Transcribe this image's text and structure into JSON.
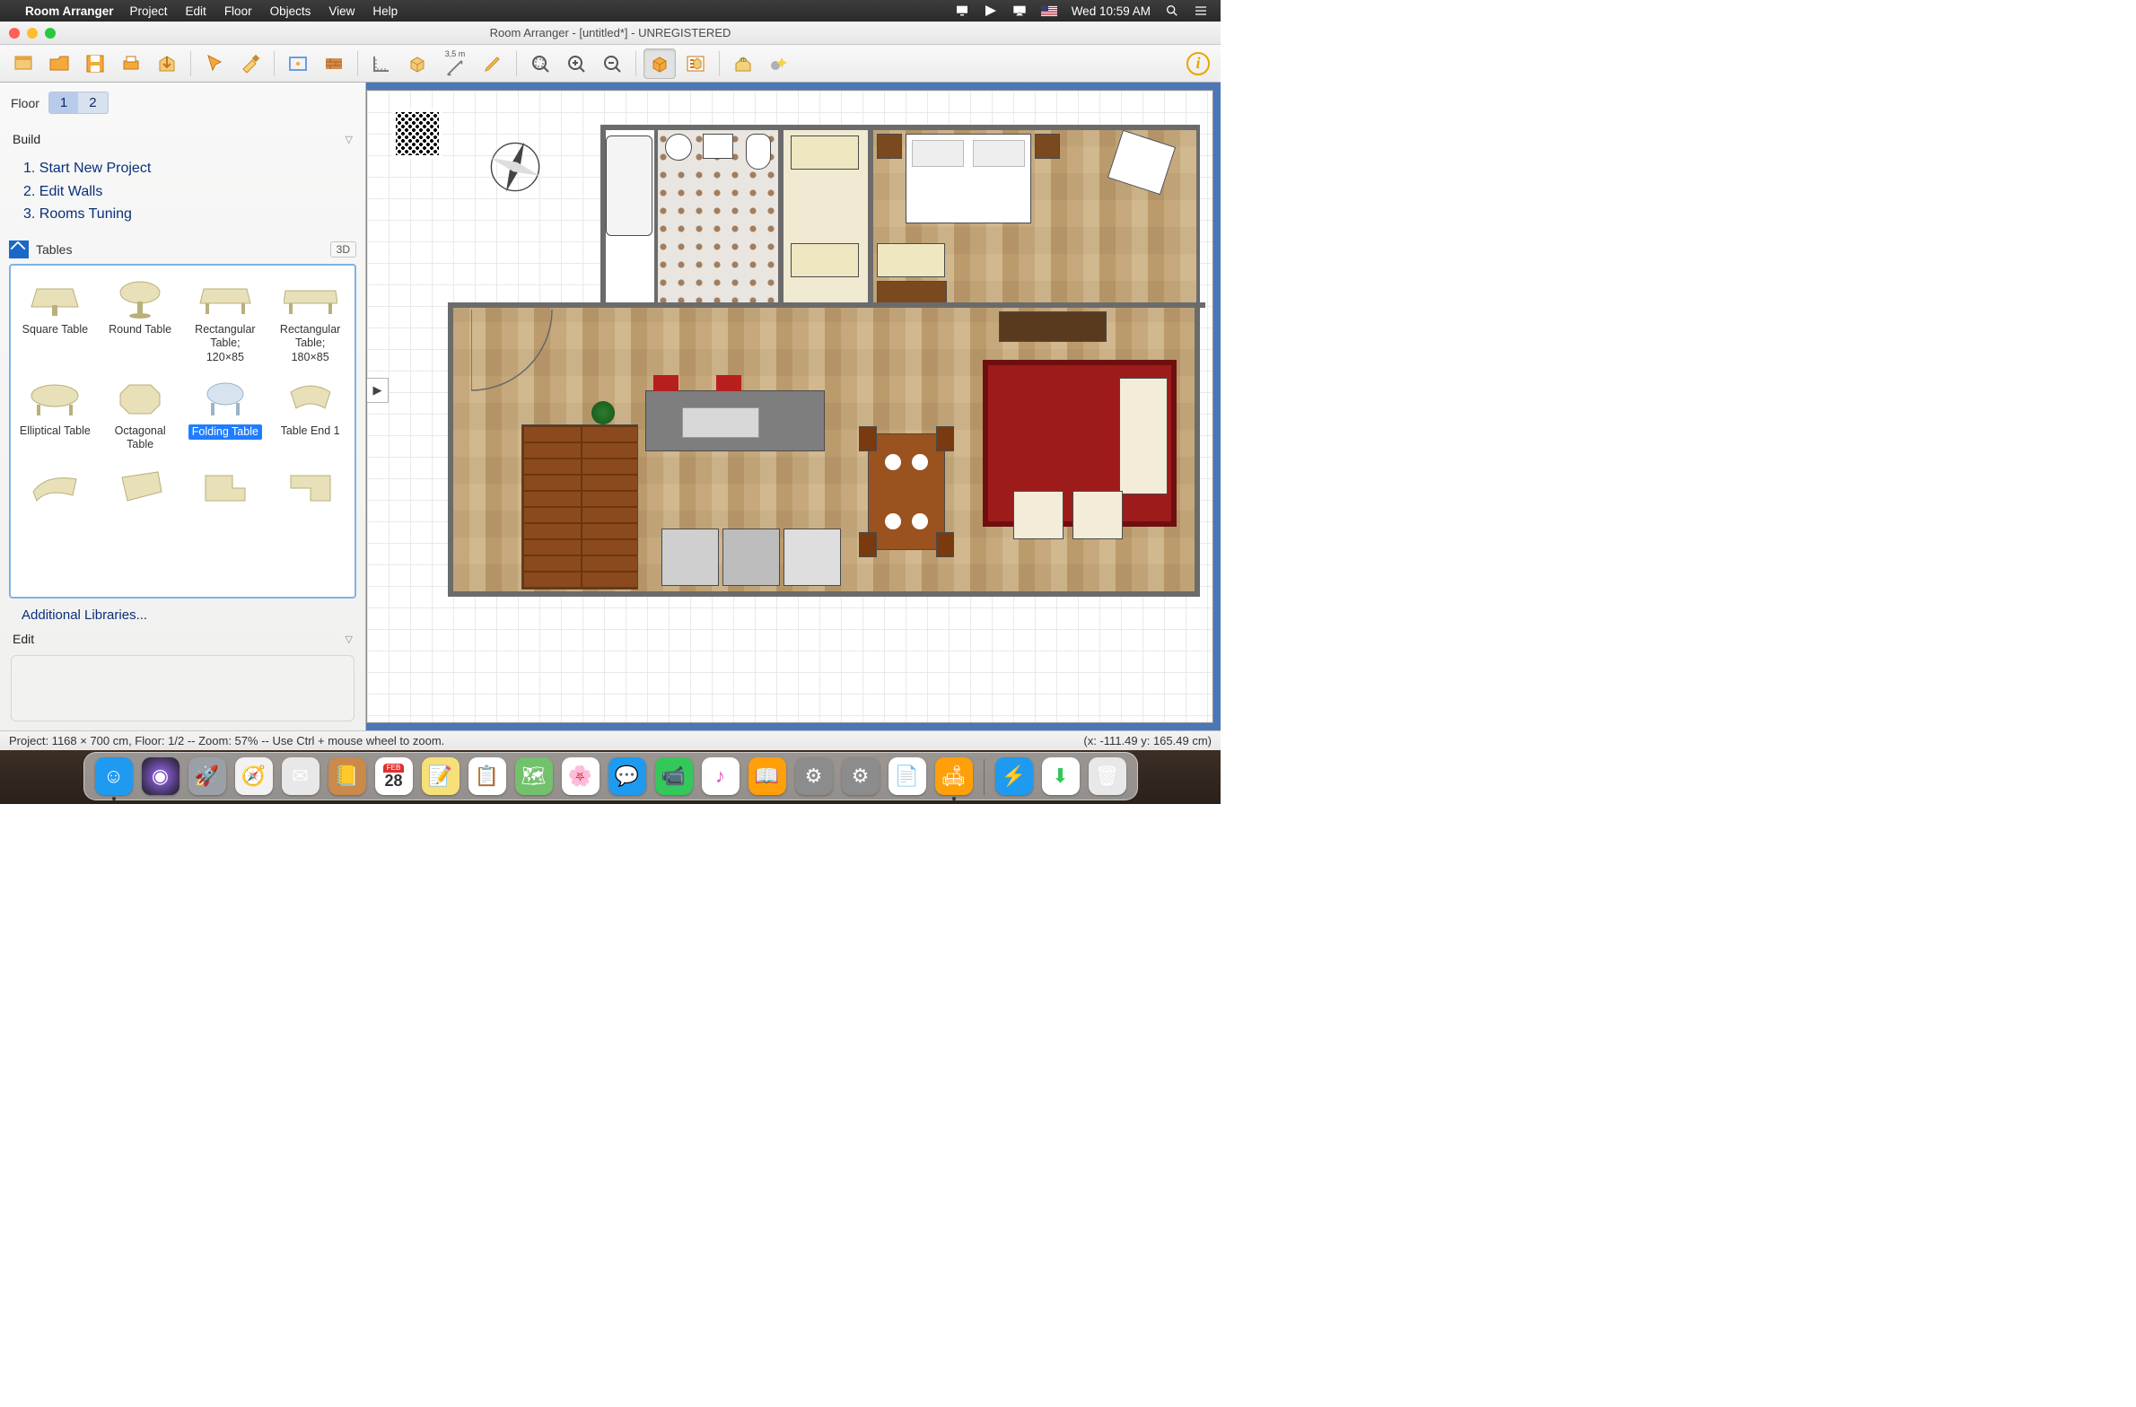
{
  "menubar": {
    "app": "Room Arranger",
    "items": [
      "Project",
      "Edit",
      "Floor",
      "Objects",
      "View",
      "Help"
    ],
    "clock": "Wed 10:59 AM"
  },
  "window": {
    "title": "Room Arranger - [untitled*] - UNREGISTERED"
  },
  "toolbar": {
    "buttons": [
      {
        "id": "new-project",
        "svg": "new"
      },
      {
        "id": "open-project",
        "svg": "open"
      },
      {
        "id": "save-project",
        "svg": "save"
      },
      {
        "id": "print",
        "svg": "print"
      },
      {
        "id": "export",
        "svg": "export"
      },
      {
        "sep": true
      },
      {
        "id": "cursor",
        "svg": "cursor"
      },
      {
        "id": "paint",
        "svg": "paint"
      },
      {
        "sep": true
      },
      {
        "id": "floor-shape",
        "svg": "floorshape"
      },
      {
        "id": "wall-tool",
        "svg": "wall"
      },
      {
        "sep": true
      },
      {
        "id": "ruler-tool",
        "svg": "rulerL"
      },
      {
        "id": "box-tool",
        "svg": "box3d"
      },
      {
        "id": "measure",
        "svg": "measure",
        "label": "3,5 m"
      },
      {
        "id": "pencil",
        "svg": "pencil"
      },
      {
        "sep": true
      },
      {
        "id": "zoom-fit",
        "svg": "zoomfit"
      },
      {
        "id": "zoom-in",
        "svg": "zoomin"
      },
      {
        "id": "zoom-out",
        "svg": "zoomout"
      },
      {
        "sep": true
      },
      {
        "id": "view-3d",
        "svg": "cube",
        "active": true
      },
      {
        "id": "object-list",
        "svg": "objlist"
      },
      {
        "sep": true
      },
      {
        "id": "render-3d",
        "svg": "house3d"
      },
      {
        "id": "effects",
        "svg": "spark"
      }
    ]
  },
  "sidebar": {
    "floor_label": "Floor",
    "floors": [
      "1",
      "2"
    ],
    "floor_selected": 0,
    "build_label": "Build",
    "build_items": [
      "1. Start New Project",
      "2. Edit Walls",
      "3. Rooms Tuning"
    ],
    "category": "Tables",
    "badge3d": "3D",
    "items": [
      {
        "label": "Square Table",
        "shape": "square"
      },
      {
        "label": "Round Table",
        "shape": "round"
      },
      {
        "label": "Rectangular Table; 120×85",
        "shape": "rect"
      },
      {
        "label": "Rectangular Table; 180×85",
        "shape": "rect-long"
      },
      {
        "label": "Elliptical Table",
        "shape": "ellipse"
      },
      {
        "label": "Octagonal Table",
        "shape": "octagon"
      },
      {
        "label": "Folding Table",
        "shape": "folding",
        "selected": true
      },
      {
        "label": "Table End 1",
        "shape": "wedge"
      },
      {
        "label": "",
        "shape": "frag1"
      },
      {
        "label": "",
        "shape": "frag2"
      },
      {
        "label": "",
        "shape": "frag3"
      },
      {
        "label": "",
        "shape": "frag4"
      }
    ],
    "additional": "Additional Libraries...",
    "edit_label": "Edit"
  },
  "status": {
    "left": "Project: 1168 × 700 cm, Floor: 1/2 -- Zoom: 57% -- Use Ctrl + mouse wheel to zoom.",
    "right": "(x: -111.49 y: 165.49 cm)"
  },
  "dock": {
    "apps": [
      {
        "id": "finder",
        "bg": "#1e9bf0",
        "glyph": "☺",
        "dot": true
      },
      {
        "id": "siri",
        "bg": "radial-gradient(circle,#a06bff,#1b1b1b)",
        "glyph": "◉"
      },
      {
        "id": "launchpad",
        "bg": "#9aa0a6",
        "glyph": "🚀"
      },
      {
        "id": "safari",
        "bg": "#f2f2f2",
        "glyph": "🧭"
      },
      {
        "id": "mail",
        "bg": "#e8e8e8",
        "glyph": "✉"
      },
      {
        "id": "contacts",
        "bg": "#c98a4b",
        "glyph": "📒"
      },
      {
        "id": "calendar",
        "bg": "#fff",
        "glyph": "28",
        "text": "#e03131",
        "dot": false,
        "sub": "FEB"
      },
      {
        "id": "notes",
        "bg": "#f7e07a",
        "glyph": "📝"
      },
      {
        "id": "reminders",
        "bg": "#fff",
        "glyph": "📋"
      },
      {
        "id": "maps",
        "bg": "#73c06d",
        "glyph": "🗺"
      },
      {
        "id": "photos",
        "bg": "#fff",
        "glyph": "🌸"
      },
      {
        "id": "messages",
        "bg": "#1e9bf0",
        "glyph": "💬"
      },
      {
        "id": "facetime",
        "bg": "#34c759",
        "glyph": "📹"
      },
      {
        "id": "itunes",
        "bg": "#fff",
        "glyph": "♪",
        "text": "#e255c3"
      },
      {
        "id": "ibooks",
        "bg": "#ff9f0a",
        "glyph": "📖"
      },
      {
        "id": "appstore",
        "bg": "#8c8c8c",
        "glyph": "⚙"
      },
      {
        "id": "preferences",
        "bg": "#8c8c8c",
        "glyph": "⚙"
      },
      {
        "id": "textedit",
        "bg": "#fff",
        "glyph": "📄"
      },
      {
        "id": "roomarranger",
        "bg": "#ff9f0a",
        "glyph": "🛋",
        "dot": true
      },
      {
        "sep": true
      },
      {
        "id": "cache",
        "bg": "#1e9bf0",
        "glyph": "⚡"
      },
      {
        "id": "downloads",
        "bg": "#fff",
        "glyph": "⬇",
        "text": "#34c759"
      },
      {
        "id": "trash",
        "bg": "#e8e8e8",
        "glyph": "🗑"
      }
    ]
  }
}
